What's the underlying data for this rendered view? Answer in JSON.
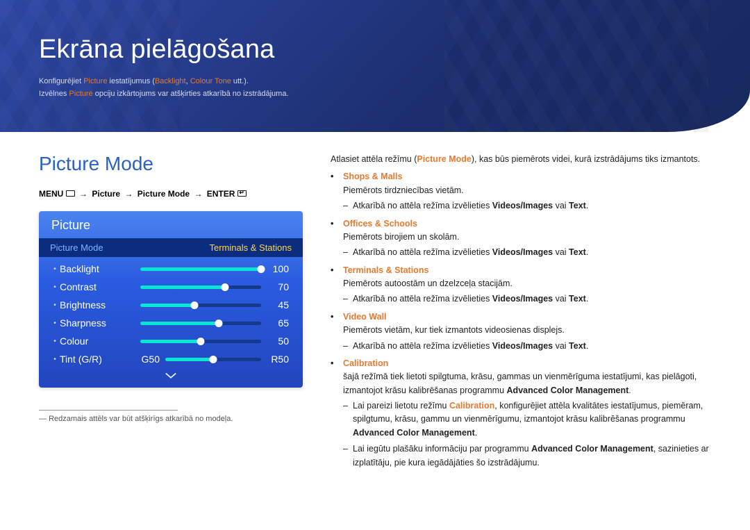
{
  "hero": {
    "title": "Ekrāna pielāgošana",
    "intro_prefix": "Konfigurējiet ",
    "intro_picture": "Picture",
    "intro_mid": " iestatījumus (",
    "intro_backlight": "Backlight",
    "intro_sep": ", ",
    "intro_colortone": "Colour Tone",
    "intro_after": " utt.).",
    "intro2_prefix": "Izvēlnes ",
    "intro2_picture": "Picture",
    "intro2_after": " opciju izkārtojums var atšķirties atkarībā no izstrādājuma."
  },
  "section_title": "Picture Mode",
  "nav": {
    "menu": "MENU",
    "arrow": "→",
    "picture": "Picture",
    "picture_mode": "Picture Mode",
    "enter": "ENTER"
  },
  "osd": {
    "header": "Picture",
    "sub_left": "Picture Mode",
    "sub_right": "Terminals & Stations",
    "rows": [
      {
        "label": "Backlight",
        "value": "100",
        "pct": 100
      },
      {
        "label": "Contrast",
        "value": "70",
        "pct": 70
      },
      {
        "label": "Brightness",
        "value": "45",
        "pct": 45
      },
      {
        "label": "Sharpness",
        "value": "65",
        "pct": 65
      },
      {
        "label": "Colour",
        "value": "50",
        "pct": 50
      }
    ],
    "tint": {
      "label": "Tint (G/R)",
      "g": "G50",
      "r": "R50"
    }
  },
  "footnote": "Redzamais attēls var būt atšķirīgs atkarībā no modeļa.",
  "right": {
    "lead_before": "Atlasiet attēla režīmu (",
    "lead_mode": "Picture Mode",
    "lead_after": "), kas būs piemērots videi, kurā izstrādājums tiks izmantots.",
    "modes": [
      {
        "name": "Shops & Malls",
        "desc": "Piemērots tirdzniecības vietām.",
        "sub_before": "Atkarībā no attēla režīma izvēlieties ",
        "sub_vi": "Videos/Images",
        "sub_or": " vai ",
        "sub_txt": "Text",
        "sub_dot": "."
      },
      {
        "name": "Offices & Schools",
        "desc": "Piemērots birojiem un skolām.",
        "sub_before": "Atkarībā no attēla režīma izvēlieties ",
        "sub_vi": "Videos/Images",
        "sub_or": " vai ",
        "sub_txt": "Text",
        "sub_dot": "."
      },
      {
        "name": "Terminals & Stations",
        "desc": "Piemērots autoostām un dzelzceļa stacijām.",
        "sub_before": "Atkarībā no attēla režīma izvēlieties ",
        "sub_vi": "Videos/Images",
        "sub_or": " vai ",
        "sub_txt": "Text",
        "sub_dot": "."
      },
      {
        "name": "Video Wall",
        "desc": "Piemērots vietām, kur tiek izmantots videosienas displejs.",
        "sub_before": "Atkarībā no attēla režīma izvēlieties ",
        "sub_vi": "Videos/Images",
        "sub_or": " vai ",
        "sub_txt": "Text",
        "sub_dot": "."
      }
    ],
    "calib": {
      "name": "Calibration",
      "desc_before": "šajā režīmā tiek lietoti spilgtuma, krāsu, gammas un vienmērīguma iestatījumi, kas pielāgoti, izmantojot krāsu kalibrēšanas programmu ",
      "desc_app": "Advanced Color Management",
      "desc_dot": ".",
      "sub1_before": "Lai pareizi lietotu režīmu ",
      "sub1_calib": "Calibration",
      "sub1_mid": ", konfigurējiet attēla kvalitātes iestatījumus, piemēram, spilgtumu, krāsu, gammu un vienmērīgumu, izmantojot krāsu kalibrēšanas programmu ",
      "sub1_app": "Advanced Color Management",
      "sub1_dot": ".",
      "sub2_before": "Lai iegūtu plašāku informāciju par programmu ",
      "sub2_app": "Advanced Color Management",
      "sub2_after": ", sazinieties ar izplatītāju, pie kura iegādājāties šo izstrādājumu."
    }
  }
}
